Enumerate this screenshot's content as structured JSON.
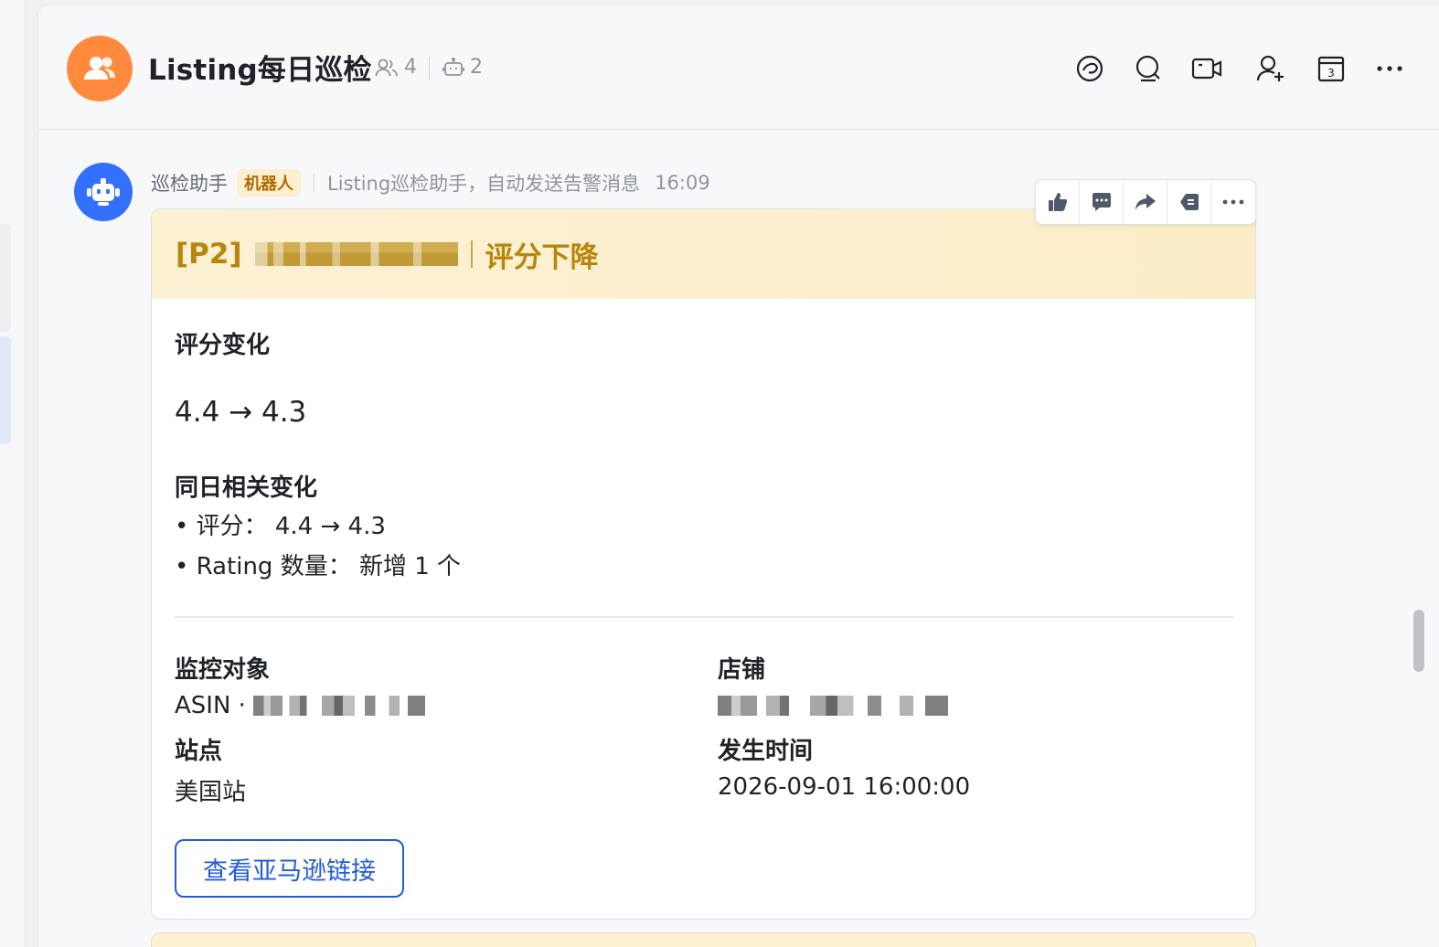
{
  "header": {
    "title": "Listing每日巡检",
    "member_count": "4",
    "bot_count": "2"
  },
  "message": {
    "sender": "巡检助手",
    "badge": "机器人",
    "description": "Listing巡检助手，自动发送告警消息",
    "time": "16:09"
  },
  "card": {
    "header_prefix": "[P2]",
    "header_suffix": "评分下降",
    "rating_change_title": "评分变化",
    "rating_change_value": "4.4 → 4.3",
    "related_title": "同日相关变化",
    "related_items": [
      "• 评分：  4.4 → 4.3",
      "• Rating 数量：  新增 1 个"
    ],
    "monitor_label": "监控对象",
    "monitor_prefix": "ASIN · ",
    "shop_label": "店铺",
    "site_label": "站点",
    "site_value": "美国站",
    "time_label": "发生时间",
    "time_value": "2026-09-01 16:00:00",
    "button_label": "查看亚马逊链接"
  },
  "colors": {
    "group_avatar": "#ff8a3d",
    "bot_avatar": "#3370ff",
    "card_header_bg": "#fdf1d4",
    "card_header_text": "#b7860b",
    "link_blue": "#245bdb"
  },
  "icons": {
    "header_actions": [
      "topic-icon",
      "search-icon",
      "video-call-icon",
      "add-member-icon",
      "calendar-icon",
      "more-icon"
    ],
    "message_toolbar": [
      "thumbs-up-icon",
      "reply-icon",
      "forward-icon",
      "pin-icon",
      "more-icon"
    ]
  }
}
